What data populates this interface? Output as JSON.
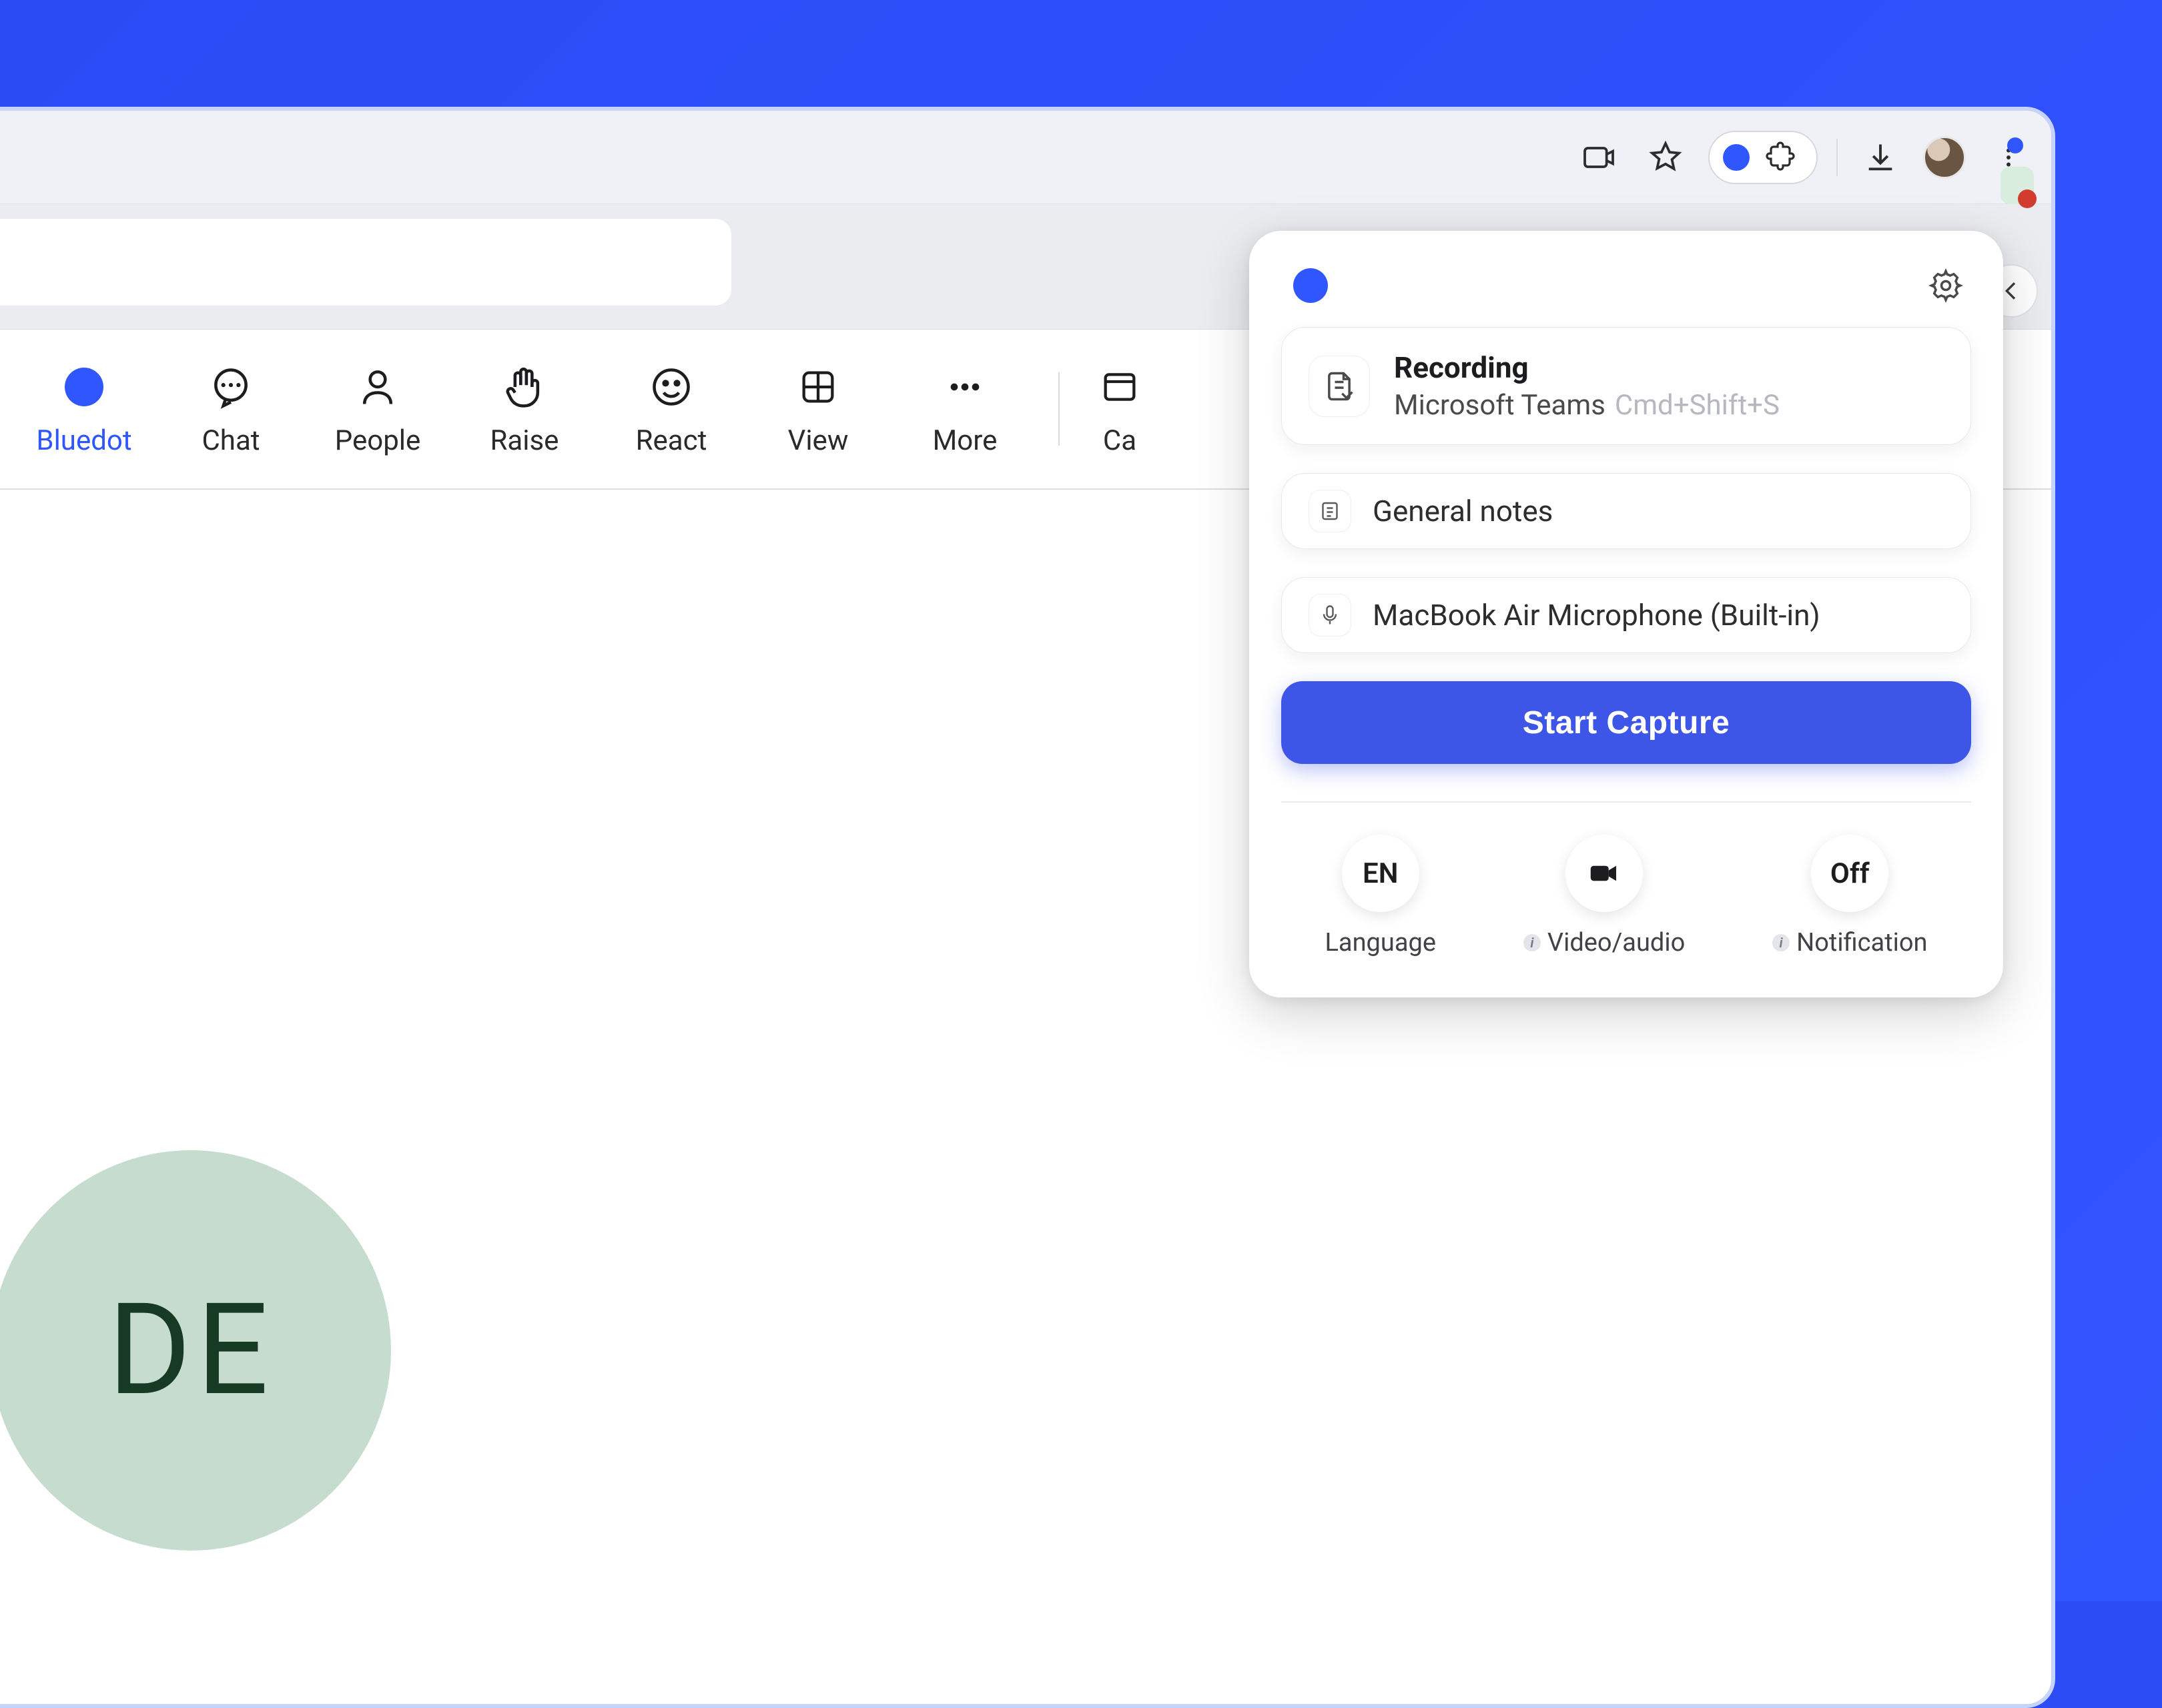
{
  "colors": {
    "accent": "#3056ff",
    "primary_button": "#3e56e8",
    "bg": "#2c4df6"
  },
  "browser": {
    "icons": [
      "video",
      "star",
      "bluedot",
      "extensions",
      "download",
      "avatar",
      "more"
    ]
  },
  "meeting_toolbar": {
    "items": [
      {
        "label": "Bluedot",
        "icon": "bluedot",
        "active": true
      },
      {
        "label": "Chat",
        "icon": "chat",
        "active": false
      },
      {
        "label": "People",
        "icon": "people",
        "active": false
      },
      {
        "label": "Raise",
        "icon": "raise-hand",
        "active": false
      },
      {
        "label": "React",
        "icon": "smile",
        "active": false
      },
      {
        "label": "View",
        "icon": "grid",
        "active": false
      },
      {
        "label": "More",
        "icon": "ellipsis",
        "active": false
      }
    ],
    "cut_label": "Ca"
  },
  "participant_avatar": "DE",
  "popup": {
    "recording": {
      "title": "Recording",
      "source": "Microsoft Teams",
      "shortcut": "Cmd+Shift+S"
    },
    "notes_label": "General notes",
    "mic_label": "MacBook Air Microphone (Built-in)",
    "start_label": "Start Capture",
    "footer": {
      "language": {
        "value": "EN",
        "label": "Language"
      },
      "video": {
        "label": "Video/audio"
      },
      "notification": {
        "value": "Off",
        "label": "Notification"
      }
    }
  }
}
